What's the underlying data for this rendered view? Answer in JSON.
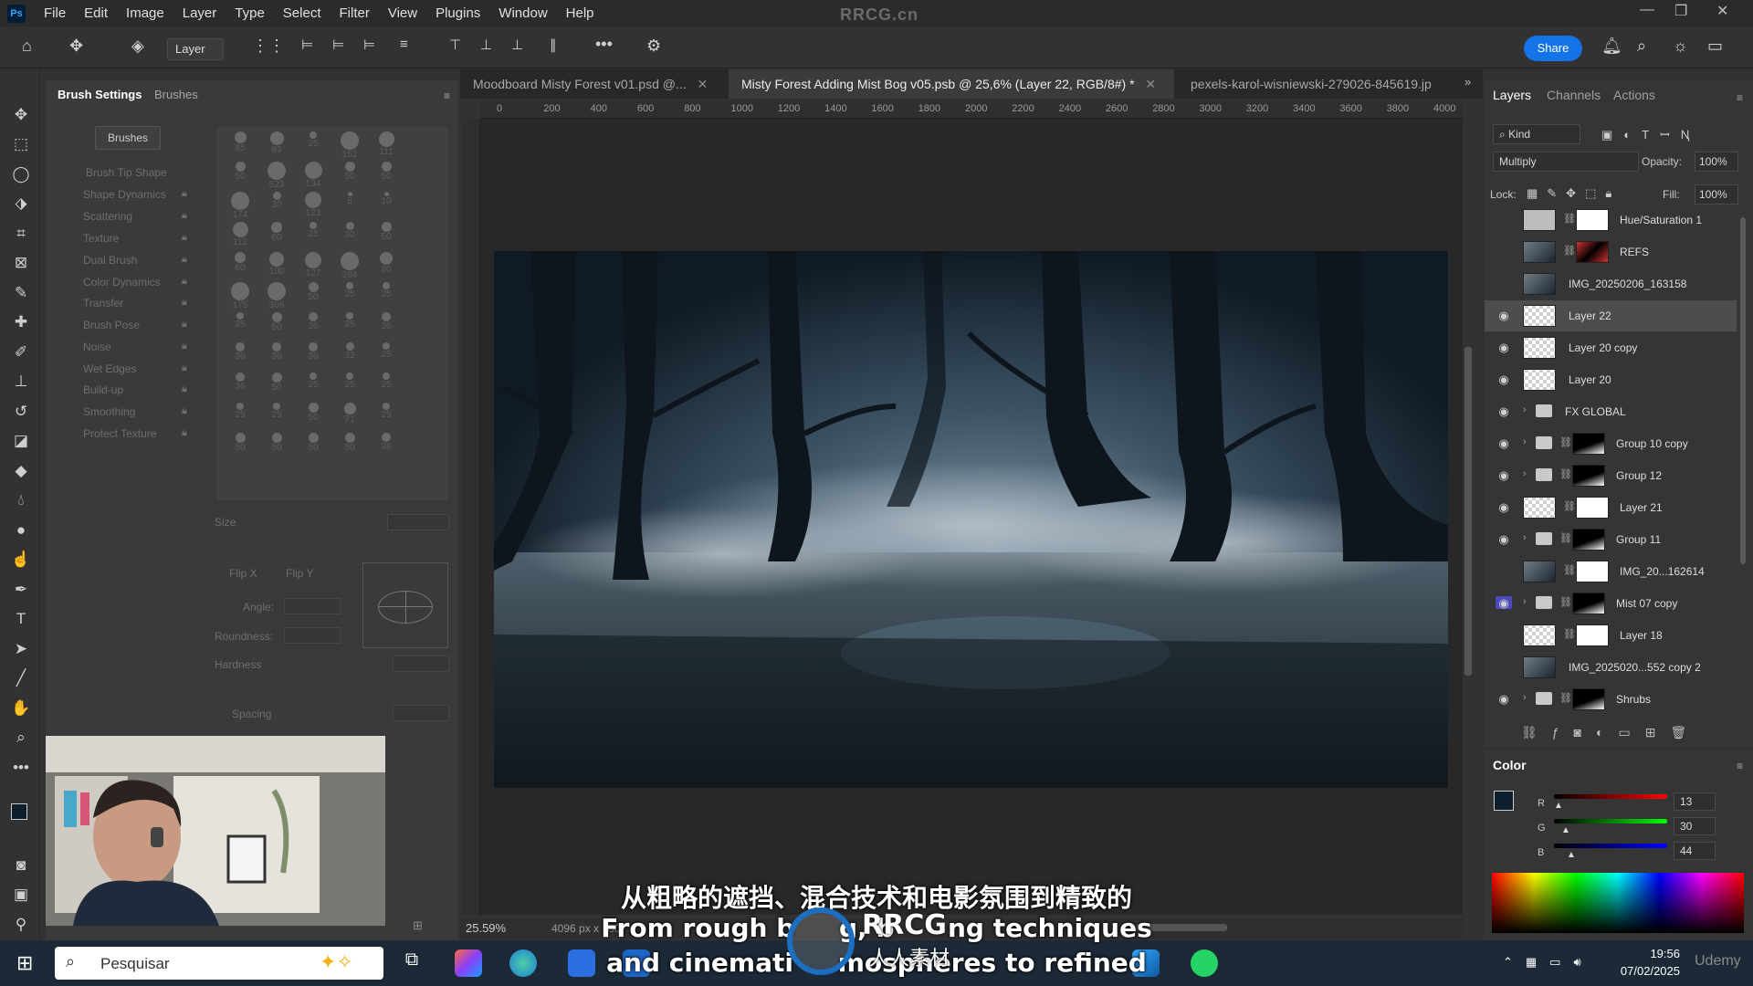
{
  "menubar": {
    "logo": "Ps",
    "items": [
      "File",
      "Edit",
      "Image",
      "Layer",
      "Type",
      "Select",
      "Filter",
      "View",
      "Plugins",
      "Window",
      "Help"
    ],
    "watermark": "RRCG.cn"
  },
  "options": {
    "layer_select": "Layer",
    "share_label": "Share"
  },
  "brush_panel": {
    "tab_active": "Brush Settings",
    "tab_other": "Brushes",
    "brushes_button": "Brushes",
    "items": [
      {
        "label": "Brush Tip Shape",
        "lock": false
      },
      {
        "label": "Shape Dynamics",
        "lock": true
      },
      {
        "label": "Scattering",
        "lock": true
      },
      {
        "label": "Texture",
        "lock": true
      },
      {
        "label": "Dual Brush",
        "lock": true
      },
      {
        "label": "Color Dynamics",
        "lock": true
      },
      {
        "label": "Transfer",
        "lock": true
      },
      {
        "label": "Brush Pose",
        "lock": true
      },
      {
        "label": "Noise",
        "lock": true
      },
      {
        "label": "Wet Edges",
        "lock": true
      },
      {
        "label": "Build-up",
        "lock": true
      },
      {
        "label": "Smoothing",
        "lock": true
      },
      {
        "label": "Protect Texture",
        "lock": true
      }
    ],
    "brush_sizes": [
      "65",
      "89",
      "25",
      "152",
      "111",
      "50",
      "523",
      "134",
      "50",
      "50",
      "174",
      "30",
      "123",
      "8",
      "10",
      "112",
      "60",
      "25",
      "30",
      "50",
      "60",
      "100",
      "127",
      "284",
      "80",
      "175",
      "306",
      "50",
      "25",
      "25",
      "25",
      "50",
      "36",
      "25",
      "36",
      "36",
      "36",
      "36",
      "32",
      "25",
      "36",
      "50",
      "25",
      "25",
      "25",
      "25",
      "25",
      "50",
      "71",
      "25",
      "50",
      "50",
      "50",
      "50",
      "36"
    ],
    "size_label": "Size",
    "flip_x": "Flip X",
    "flip_y": "Flip Y",
    "angle_label": "Angle:",
    "roundness_label": "Roundness:",
    "hardness_label": "Hardness",
    "spacing_label": "Spacing"
  },
  "doc_tabs": [
    {
      "label": "Moodboard Misty Forest v01.psd @...",
      "active": false
    },
    {
      "label": "Misty Forest Adding Mist Bog v05.psb @ 25,6% (Layer 22, RGB/8#) *",
      "active": true
    },
    {
      "label": "pexels-karol-wisniewski-279026-845619.jp",
      "active": false
    }
  ],
  "ruler_ticks": [
    "0",
    "200",
    "400",
    "600",
    "800",
    "1000",
    "1200",
    "1400",
    "1600",
    "1800",
    "2000",
    "2200",
    "2400",
    "2600",
    "2800",
    "3000",
    "3200",
    "3400",
    "3600",
    "3800",
    "4000"
  ],
  "status": {
    "zoom": "25.59%",
    "doc_size": "4096 px x 230"
  },
  "layers_panel": {
    "tabs": [
      "Layers",
      "Channels",
      "Actions"
    ],
    "kind_label": "Kind",
    "blend_mode": "Multiply",
    "opacity_label": "Opacity:",
    "opacity_value": "100%",
    "lock_label": "Lock:",
    "fill_label": "Fill:",
    "fill_value": "100%",
    "layers": [
      {
        "name": "Hue/Saturation 1",
        "visible": false,
        "type": "adjustment",
        "group": false,
        "mask": true
      },
      {
        "name": "REFS",
        "visible": false,
        "type": "image",
        "group": false,
        "mask": true
      },
      {
        "name": "IMG_20250206_163158",
        "visible": false,
        "type": "image",
        "group": false,
        "mask": false
      },
      {
        "name": "Layer 22",
        "visible": true,
        "type": "pixel",
        "group": false,
        "mask": false,
        "selected": true
      },
      {
        "name": "Layer 20 copy",
        "visible": true,
        "type": "pixel",
        "group": false,
        "mask": false
      },
      {
        "name": "Layer 20",
        "visible": true,
        "type": "pixel",
        "group": false,
        "mask": false
      },
      {
        "name": "FX GLOBAL",
        "visible": true,
        "type": "group",
        "group": true,
        "mask": false
      },
      {
        "name": "Group 10 copy",
        "visible": true,
        "type": "group",
        "group": true,
        "mask": true
      },
      {
        "name": "Group 12",
        "visible": true,
        "type": "group",
        "group": true,
        "mask": true
      },
      {
        "name": "Layer 21",
        "visible": true,
        "type": "pixel",
        "group": false,
        "mask": true
      },
      {
        "name": "Group 11",
        "visible": true,
        "type": "group",
        "group": true,
        "mask": true
      },
      {
        "name": "IMG_20...162614",
        "visible": false,
        "type": "image",
        "group": false,
        "mask": true
      },
      {
        "name": "Mist 07 copy",
        "visible": true,
        "type": "group",
        "group": true,
        "mask": true,
        "hilite": true
      },
      {
        "name": "Layer 18",
        "visible": false,
        "type": "pixel",
        "group": false,
        "mask": true
      },
      {
        "name": "IMG_2025020...552 copy 2",
        "visible": false,
        "type": "image",
        "group": false,
        "mask": false
      },
      {
        "name": "Shrubs",
        "visible": true,
        "type": "group",
        "group": true,
        "mask": true
      }
    ]
  },
  "color_panel": {
    "title": "Color",
    "r_label": "R",
    "r_value": "13",
    "g_label": "G",
    "g_value": "30",
    "b_label": "B",
    "b_value": "44",
    "foreground": "#0d1e2c"
  },
  "subtitles": {
    "cn": "从粗略的遮挡、混合技术和电影氛围到精致的",
    "en1": "From rough b     g, b      ng techniques",
    "en2": "and cinemati     mospheres to refined",
    "logo_text": "RRCG",
    "logo_sub": "人人素材"
  },
  "taskbar": {
    "search_placeholder": "Pesquisar",
    "time": "19:56",
    "date": "07/02/2025",
    "udemy": "Udemy"
  },
  "colors": {
    "accent": "#1473e6",
    "selection": "#4b4bbf"
  }
}
